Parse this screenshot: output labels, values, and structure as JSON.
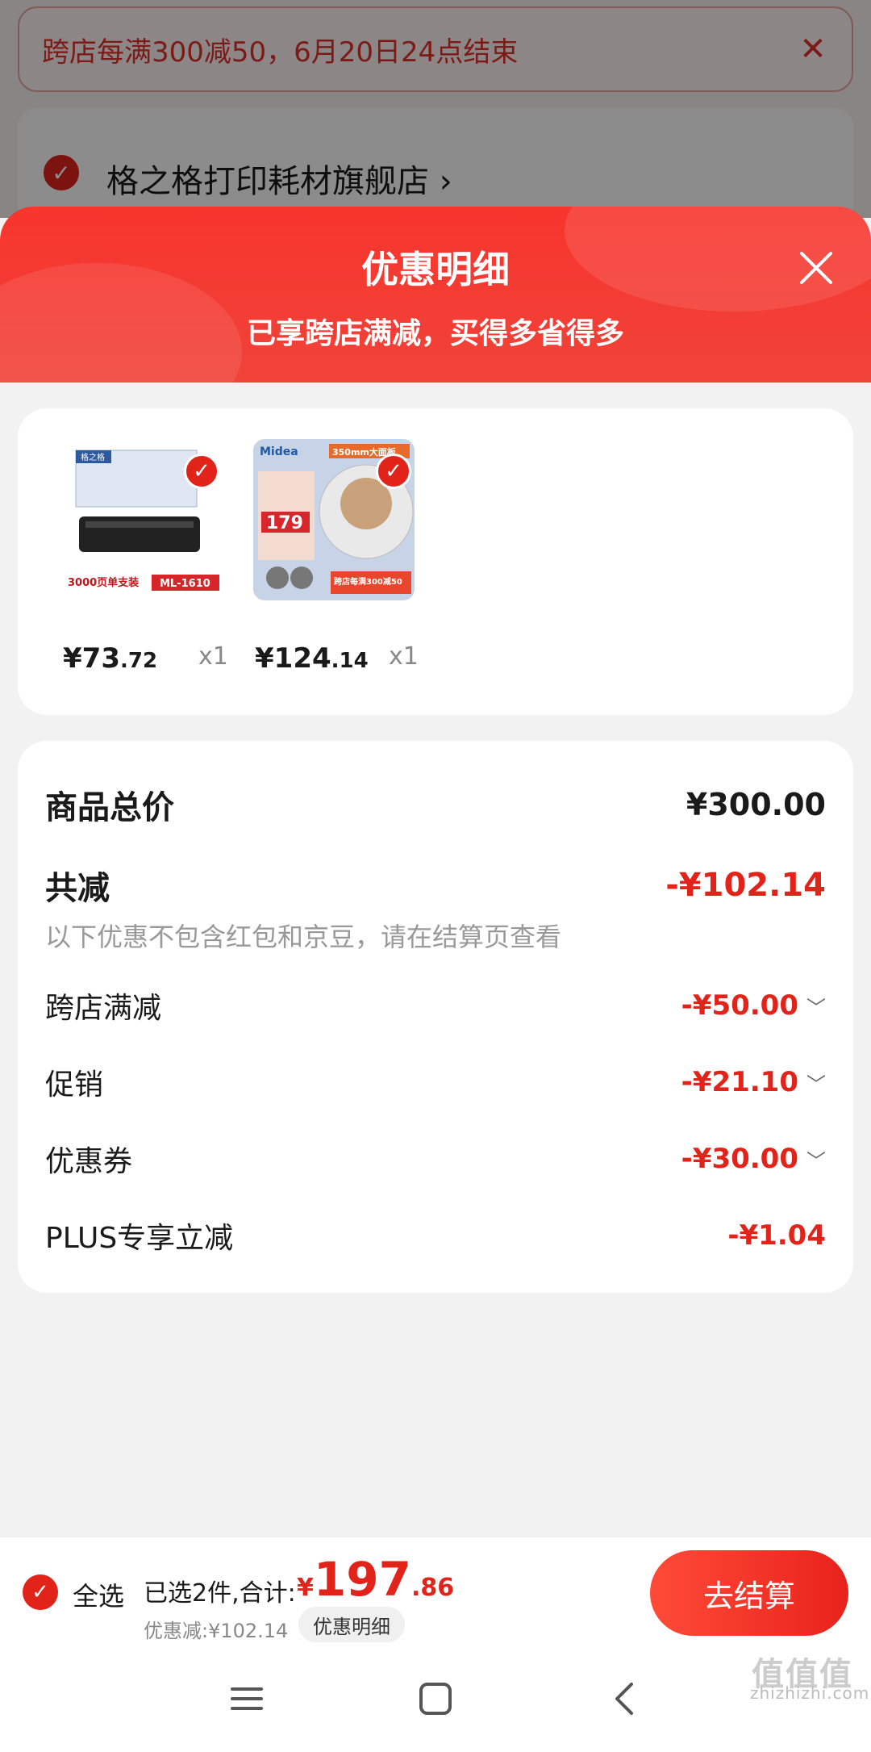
{
  "background": {
    "promo_text": "跨店每满300减50，6月20日24点结束",
    "store_name": "格之格打印耗材旗舰店 ›"
  },
  "sheet": {
    "title": "优惠明细",
    "subtitle": "已享跨店满减，买得多省得多"
  },
  "products": [
    {
      "image_texts": [
        "格之格",
        "3000页单支装",
        "ML-1610"
      ],
      "price_int": "¥73",
      "price_dec": ".72",
      "qty": "x1"
    },
    {
      "image_texts": [
        "Midea",
        "350mm大面板",
        "179",
        "跨店每满300减50"
      ],
      "price_int": "¥124",
      "price_dec": ".14",
      "qty": "x1"
    }
  ],
  "summary": {
    "total_label": "商品总价",
    "total_value": "¥300.00",
    "reduce_label": "共减",
    "reduce_value": "-¥102.14",
    "note": "以下优惠不包含红包和京豆，请在结算页查看",
    "items": [
      {
        "label": "跨店满减",
        "value": "-¥50.00",
        "expandable": true
      },
      {
        "label": "促销",
        "value": "-¥21.10",
        "expandable": true
      },
      {
        "label": "优惠券",
        "value": "-¥30.00",
        "expandable": true
      },
      {
        "label": "PLUS专享立减",
        "value": "-¥1.04",
        "expandable": false
      }
    ]
  },
  "checkout": {
    "select_all": "全选",
    "selected_text": "已选2件,合计:",
    "total_currency": "¥",
    "total_int": "197",
    "total_dec": ".86",
    "discount_text": "优惠减:¥102.14",
    "detail_button": "优惠明细",
    "checkout_button": "去结算"
  },
  "watermark": {
    "big": "值值值",
    "url": "zhizhizhi.com"
  },
  "colors": {
    "accent_red": "#e2231a",
    "header_red": "#f7352d"
  }
}
